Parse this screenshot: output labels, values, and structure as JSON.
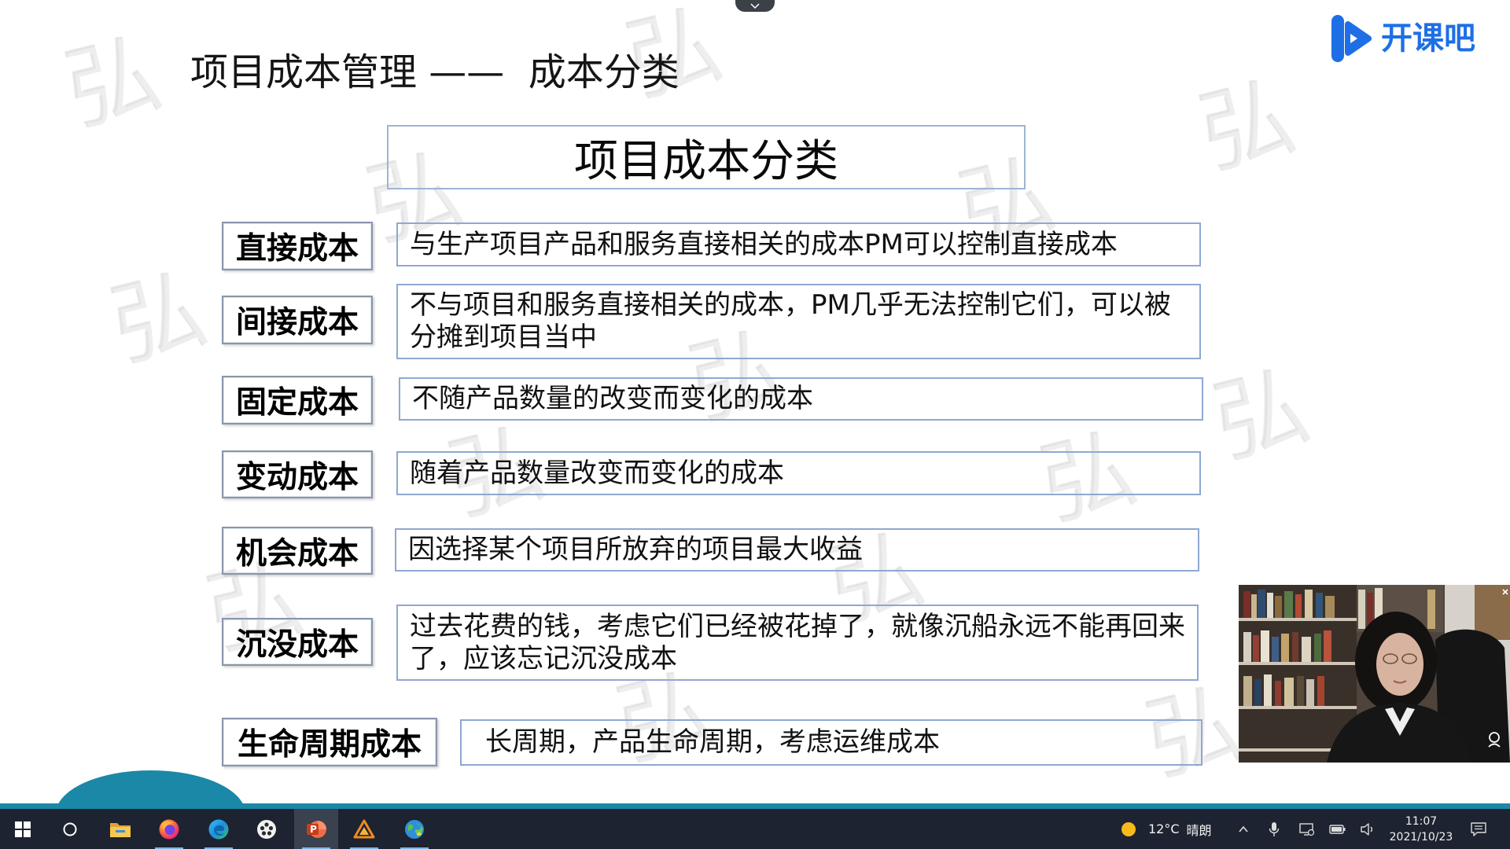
{
  "top_handle": {
    "icon": "chevron-down-icon"
  },
  "logo": {
    "text": "开课吧",
    "icon": "kaikeba-logo-icon"
  },
  "slide": {
    "title": "项目成本管理 ——  成本分类",
    "header": "项目成本分类",
    "watermark": "弘",
    "rows": [
      {
        "label": "直接成本",
        "lines": [
          "与生产项目产品和服务直接相关的成本PM可以控制直接成本"
        ]
      },
      {
        "label": "间接成本",
        "lines": [
          "不与项目和服务直接相关的成本，PM几乎无法控制它们，可以被",
          "分摊到项目当中"
        ]
      },
      {
        "label": "固定成本",
        "lines": [
          "不随产品数量的改变而变化的成本"
        ]
      },
      {
        "label": "变动成本",
        "lines": [
          "随着产品数量改变而变化的成本"
        ]
      },
      {
        "label": "机会成本",
        "lines": [
          "因选择某个项目所放弃的项目最大收益"
        ]
      },
      {
        "label": "沉没成本",
        "lines": [
          "过去花费的钱，考虑它们已经被花掉了，就像沉船永远不能再回来",
          "了，应该忘记沉没成本"
        ]
      },
      {
        "label": "生命周期成本",
        "lines": [
          "长周期，产品生命周期，考虑运维成本"
        ]
      }
    ]
  },
  "presenter_video": {
    "icon": "presenter-webcam-feed"
  },
  "taskbar": {
    "apps": [
      "windows-icon",
      "search-icon",
      "folder-icon",
      "firefox-icon",
      "edge-icon",
      "dots-app-icon",
      "powerpoint-icon",
      "triangle-app-icon",
      "globe-icon"
    ],
    "active_app": "powerpoint-icon",
    "powerpoint_letter": "P",
    "weather": {
      "icon": "sun-icon",
      "temp": "12°C",
      "condition": "晴朗"
    },
    "tray_icons": [
      "chevron-up-icon",
      "microphone-icon",
      "network-icon",
      "battery-icon",
      "volume-icon"
    ],
    "clock": {
      "time": "11:07",
      "date": "2021/10/23"
    },
    "notification_icon": "notification-icon"
  },
  "colors": {
    "accent_teal": "#1a88a6",
    "logo_blue": "#1e6fe6",
    "box_border": "#8ea8d2",
    "label_border": "#8896aa",
    "taskbar_bg": "#1d2330"
  }
}
